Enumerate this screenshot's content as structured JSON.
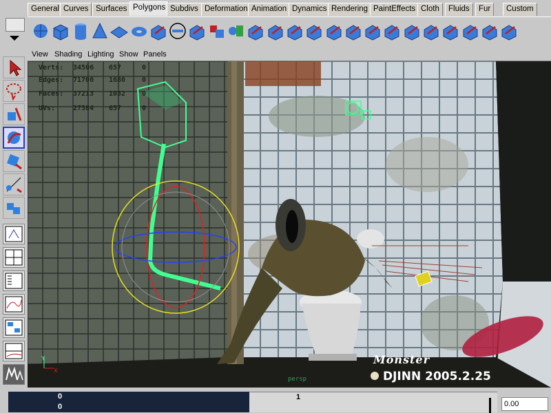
{
  "shelf": {
    "tabs": [
      "General",
      "Curves",
      "Surfaces",
      "Polygons",
      "Subdivs",
      "Deformation",
      "Animation",
      "Dynamics",
      "Rendering",
      "PaintEffects",
      "Cloth",
      "Fluids",
      "Fur",
      "Custom"
    ],
    "active_tab": "Polygons",
    "icons": [
      "poly-sphere-icon",
      "poly-cube-icon",
      "poly-cylinder-icon",
      "poly-cone-icon",
      "poly-plane-icon",
      "poly-torus-icon",
      "poly-pipe-icon",
      "poly-helix-icon",
      "extract-icon",
      "split-icon",
      "combine-icon",
      "separate-icon",
      "smooth-icon",
      "extrude-face-icon",
      "extrude-edge-icon",
      "bevel-icon",
      "wedge-icon",
      "merge-icon",
      "collapse-icon",
      "append-icon",
      "split-poly-icon",
      "cut-face-icon",
      "subdivide-icon",
      "triangulate-icon",
      "quadrangulate-icon"
    ]
  },
  "panel_menu": [
    "View",
    "Shading",
    "Lighting",
    "Show",
    "Panels"
  ],
  "hud": {
    "rows": [
      {
        "label": "Verts:",
        "v1": "34506",
        "v2": "657",
        "v3": "0"
      },
      {
        "label": "Edges:",
        "v1": "71700",
        "v2": "1680",
        "v3": "0"
      },
      {
        "label": "Faces:",
        "v1": "37213",
        "v2": "1032",
        "v3": "0"
      },
      {
        "label": "UVs:",
        "v1": "27584",
        "v2": "657",
        "v3": "0"
      }
    ]
  },
  "viewport": {
    "camera_label": "persp",
    "watermark_title": "Monster",
    "watermark_credit": "DJINN 2005.2.25"
  },
  "time": {
    "track_top": "0",
    "track_bottom": "0",
    "frame_marker": "1",
    "current_time": "0.00"
  },
  "colors": {
    "wireframe": "#40ff90",
    "manipulator": "#e8e020",
    "ui_bg": "#c8c8c8",
    "track_bg": "#18243a"
  }
}
